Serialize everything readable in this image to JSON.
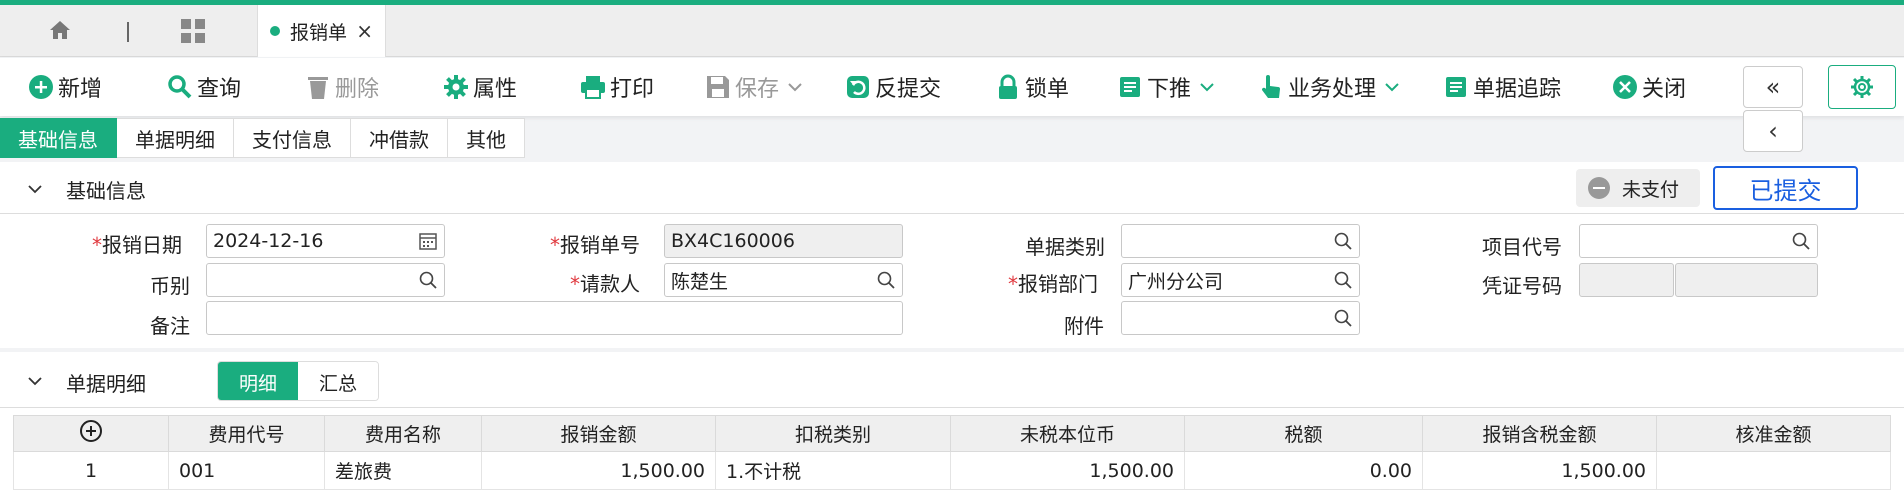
{
  "doc_tab": {
    "label": "报销单"
  },
  "toolbar": {
    "add": "新增",
    "query": "查询",
    "delete": "删除",
    "properties": "属性",
    "print": "打印",
    "save": "保存",
    "unsubmit": "反提交",
    "lock": "锁单",
    "push_down": "下推",
    "business": "业务处理",
    "trace": "单据追踪",
    "close": "关闭",
    "accent_color": "#1aad7f"
  },
  "section_tabs": [
    "基础信息",
    "单据明细",
    "支付信息",
    "冲借款",
    "其他"
  ],
  "basic": {
    "title": "基础信息",
    "unpaid_label": "未支付",
    "submitted_label": "已提交",
    "fields": {
      "date_label": "报销日期",
      "date_value": "2024-12-16",
      "no_label": "报销单号",
      "no_value": "BX4C160006",
      "category_label": "单据类别",
      "category_value": "",
      "project_label": "项目代号",
      "project_value": "",
      "currency_label": "币别",
      "currency_value": "",
      "payee_label": "请款人",
      "payee_value": "陈楚生",
      "dept_label": "报销部门",
      "dept_value": "广州分公司",
      "voucher_label": "凭证号码",
      "remark_label": "备注",
      "remark_value": "",
      "attachment_label": "附件",
      "attachment_value": ""
    }
  },
  "detail": {
    "title": "单据明细",
    "subtabs": [
      "明细",
      "汇总"
    ],
    "columns": [
      "费用代号",
      "费用名称",
      "报销金额",
      "扣税类别",
      "未税本位币",
      "税额",
      "报销含税金额",
      "核准金额"
    ],
    "rows": [
      {
        "index": "1",
        "code": "001",
        "name": "差旅费",
        "amount": "1,500.00",
        "tax_type": "1.不计税",
        "pretax": "1,500.00",
        "tax": "0.00",
        "total": "1,500.00",
        "approved": ""
      }
    ]
  }
}
